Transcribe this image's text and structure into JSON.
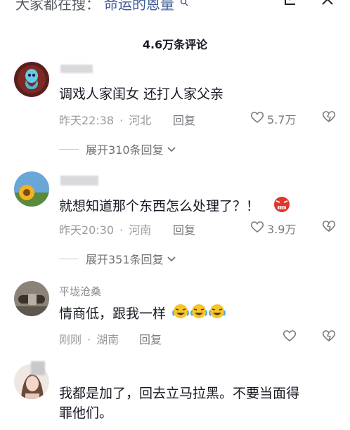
{
  "search": {
    "prefix": "大家都在搜：",
    "hint": "命运的恩量"
  },
  "header": {
    "comment_count": "4.6万条评论"
  },
  "comments": [
    {
      "username": "",
      "text": "调戏人家闺女 还打人家父亲",
      "time": "昨天22:38",
      "location": "河北",
      "reply": "回复",
      "likes": "5.7万",
      "expand": "展开310条回复"
    },
    {
      "username": "",
      "text": "就想知道那个东西怎么处理了？！",
      "time": "昨天20:30",
      "location": "河南",
      "reply": "回复",
      "likes": "3.9万",
      "expand": "展开351条回复"
    },
    {
      "username": "平垅沧桑",
      "text": "情商低，跟我一样",
      "time": "刚刚",
      "location": "湖南",
      "reply": "回复",
      "likes": ""
    },
    {
      "username": "",
      "text_line1": "我都是加了，回去立马拉黑。不要当面得",
      "text_line2": "罪他们。"
    }
  ],
  "colors": {
    "accent_link": "#3d5a99",
    "text": "#161823",
    "meta": "#9a9ba0",
    "angry_emoji": "#e0362c"
  },
  "icons": [
    "search-icon",
    "share-icon",
    "close-icon",
    "heart-icon",
    "dislike-heart-icon",
    "chevron-down-icon",
    "angry-emoji-icon",
    "laugh-cry-emoji-icon"
  ]
}
